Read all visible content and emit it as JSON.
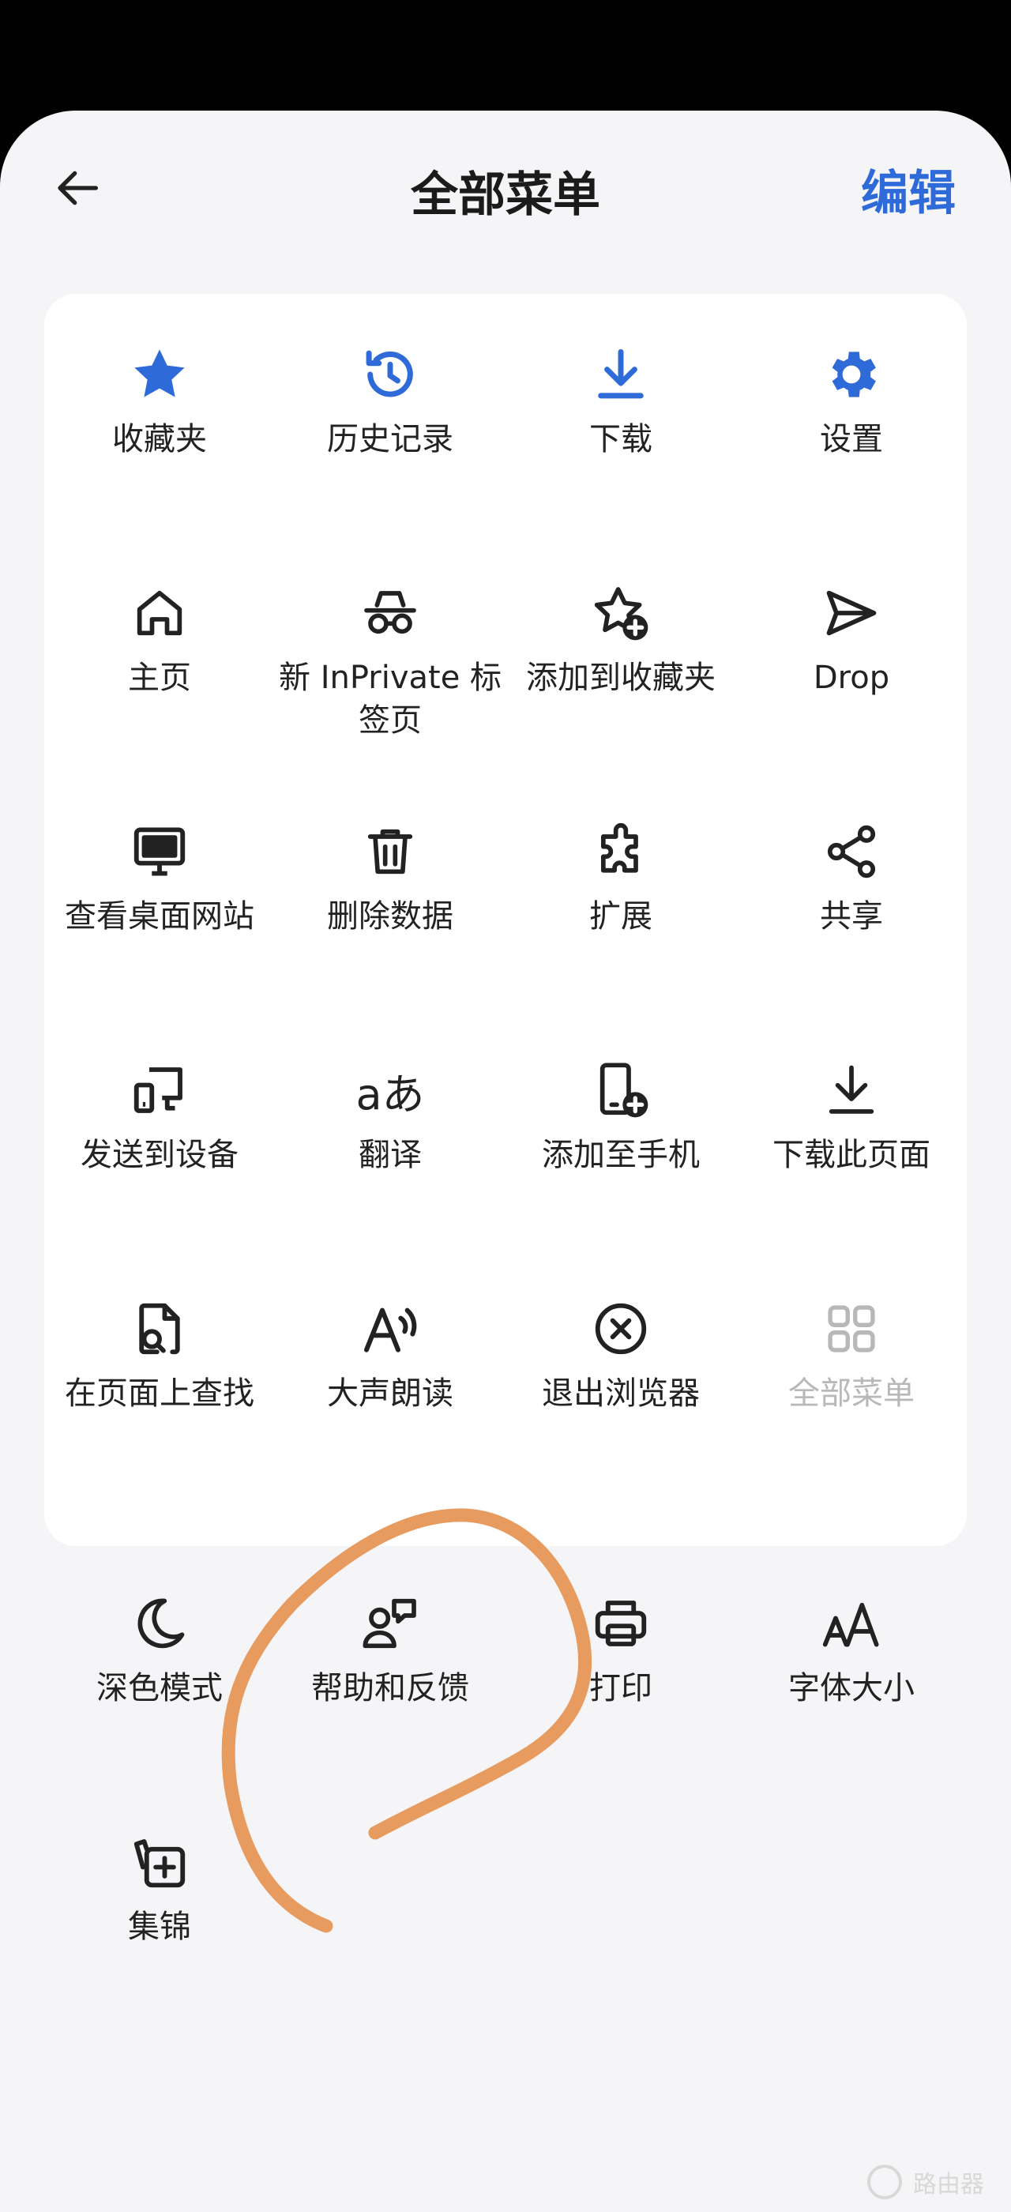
{
  "header": {
    "title": "全部菜单",
    "edit_label": "编辑",
    "back_icon": "arrow-left-icon"
  },
  "colors": {
    "accent": "#2f6ad9",
    "sheet_bg": "#f5f5f7",
    "card_bg": "#ffffff",
    "icon": "#222222",
    "disabled": "#b8b8b8",
    "annotation_stroke": "#e89b5f"
  },
  "card_items": [
    {
      "label": "收藏夹",
      "icon": "star-icon"
    },
    {
      "label": "历史记录",
      "icon": "history-icon"
    },
    {
      "label": "下载",
      "icon": "download-icon"
    },
    {
      "label": "设置",
      "icon": "gear-icon"
    },
    {
      "label": "主页",
      "icon": "home-icon"
    },
    {
      "label": "新 InPrivate 标签页",
      "icon": "inprivate-icon"
    },
    {
      "label": "添加到收藏夹",
      "icon": "star-add-icon"
    },
    {
      "label": "Drop",
      "icon": "send-icon"
    },
    {
      "label": "查看桌面网站",
      "icon": "desktop-icon"
    },
    {
      "label": "删除数据",
      "icon": "trash-icon"
    },
    {
      "label": "扩展",
      "icon": "puzzle-icon"
    },
    {
      "label": "共享",
      "icon": "share-icon"
    },
    {
      "label": "发送到设备",
      "icon": "send-to-device-icon"
    },
    {
      "label": "翻译",
      "icon": "translate-icon"
    },
    {
      "label": "添加至手机",
      "icon": "phone-add-icon"
    },
    {
      "label": "下载此页面",
      "icon": "download-page-icon"
    },
    {
      "label": "在页面上查找",
      "icon": "find-in-page-icon"
    },
    {
      "label": "大声朗读",
      "icon": "read-aloud-icon"
    },
    {
      "label": "退出浏览器",
      "icon": "exit-icon"
    },
    {
      "label": "全部菜单",
      "icon": "grid-icon",
      "disabled": true
    }
  ],
  "extra_items": [
    {
      "label": "深色模式",
      "icon": "moon-icon"
    },
    {
      "label": "帮助和反馈",
      "icon": "help-feedback-icon"
    },
    {
      "label": "打印",
      "icon": "printer-icon"
    },
    {
      "label": "字体大小",
      "icon": "font-size-icon"
    },
    {
      "label": "集锦",
      "icon": "collections-icon"
    }
  ],
  "watermark": {
    "text": "路由器"
  }
}
